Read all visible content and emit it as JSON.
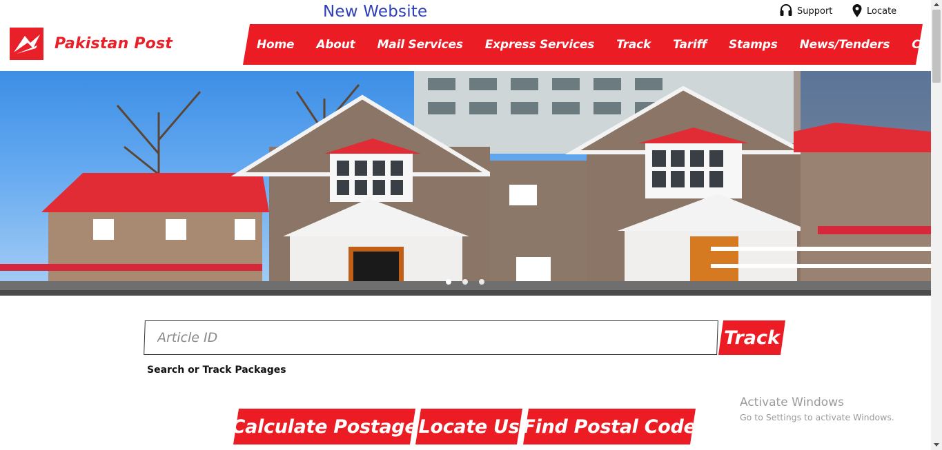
{
  "header": {
    "banner_text": "New Website",
    "support_label": "Support",
    "locate_label": "Locate",
    "logo_text": "Pakistan Post"
  },
  "nav": {
    "items": [
      "Home",
      "About",
      "Mail Services",
      "Express Services",
      "Track",
      "Tariff",
      "Stamps",
      "News/Tenders",
      "Contact Us"
    ]
  },
  "hero": {
    "slide_count": 3,
    "active_slide": 1
  },
  "track": {
    "input_placeholder": "Article ID",
    "input_value": "",
    "button_label": "Track",
    "caption": "Search or Track Packages"
  },
  "actions": {
    "calculate": "Calculate Postage",
    "locate": "Locate Us",
    "find_code": "Find Postal Code"
  },
  "watermark": {
    "title": "Activate Windows",
    "subtitle": "Go to Settings to activate Windows."
  },
  "colors": {
    "brand_red": "#ec1c24",
    "banner_blue": "#2f3fb6"
  },
  "icons": {
    "support": "headset-icon",
    "locate": "map-pin-icon",
    "logo": "pakistan-post-logo-icon"
  }
}
